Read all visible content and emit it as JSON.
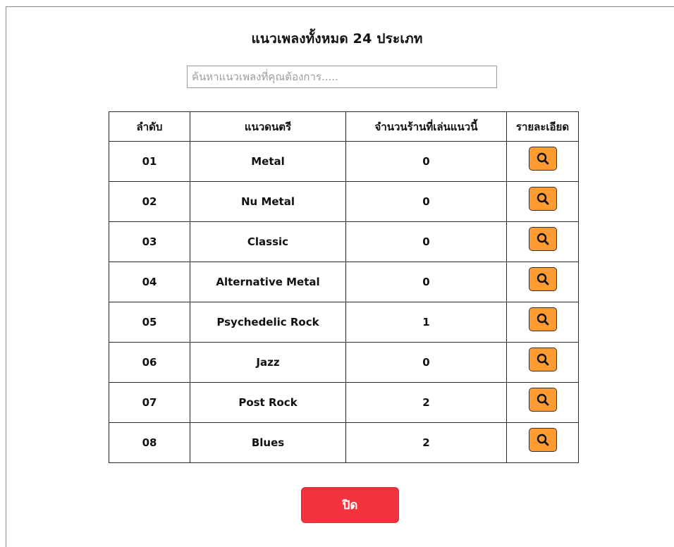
{
  "title": "แนวเพลงทั้งหมด 24 ประเภท",
  "search": {
    "placeholder": "ค้นหาแนวเพลงที่คุณต้องการ....."
  },
  "table": {
    "headers": [
      "ลำดับ",
      "แนวดนตรี",
      "จำนวนร้านที่เล่นแนวนี้",
      "รายละเอียด"
    ],
    "rows": [
      {
        "no": "01",
        "genre": "Metal",
        "count": "0"
      },
      {
        "no": "02",
        "genre": "Nu Metal",
        "count": "0"
      },
      {
        "no": "03",
        "genre": "Classic",
        "count": "0"
      },
      {
        "no": "04",
        "genre": "Alternative Metal",
        "count": "0"
      },
      {
        "no": "05",
        "genre": "Psychedelic Rock",
        "count": "1"
      },
      {
        "no": "06",
        "genre": "Jazz",
        "count": "0"
      },
      {
        "no": "07",
        "genre": "Post Rock",
        "count": "2"
      },
      {
        "no": "08",
        "genre": "Blues",
        "count": "2"
      }
    ],
    "detail_icon": "search-icon"
  },
  "close_button": {
    "label": "ปิด"
  },
  "colors": {
    "detail_button": "#ff9b30",
    "close_button": "#f4323d"
  }
}
